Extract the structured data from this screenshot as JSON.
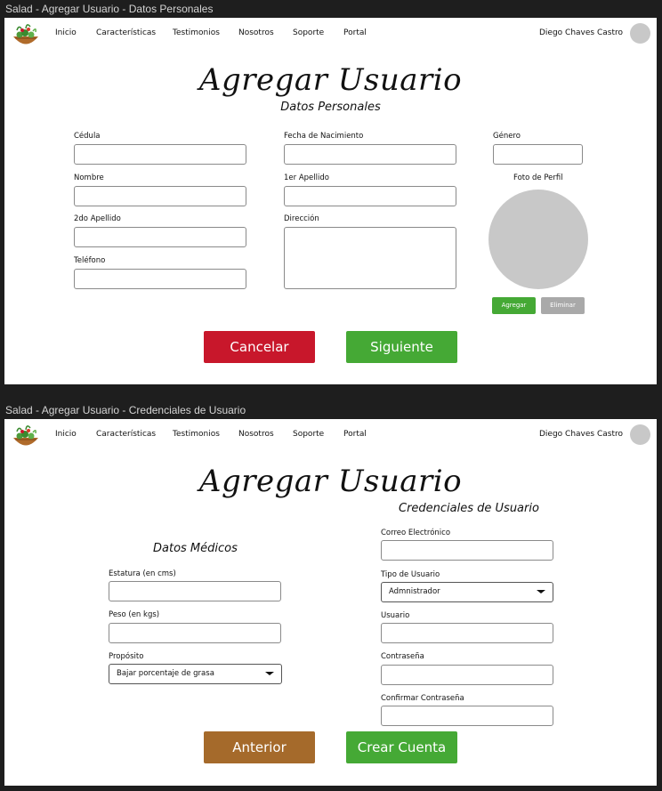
{
  "frames": [
    {
      "title": "Salad - Agregar Usuario - Datos Personales"
    },
    {
      "title": "Salad - Agregar Usuario - Credenciales de Usuario"
    }
  ],
  "nav": {
    "items": [
      "Inicio",
      "Características",
      "Testimonios",
      "Nosotros",
      "Soporte",
      "Portal"
    ],
    "user_name": "Diego Chaves Castro"
  },
  "page_title": "Agregar Usuario",
  "personal": {
    "subtitle": "Datos Personales",
    "fields": {
      "cedula": "Cédula",
      "fecha_nacimiento": "Fecha de Nacimiento",
      "genero": "Género",
      "nombre": "Nombre",
      "primer_apellido": "1er Apellido",
      "segundo_apellido": "2do Apellido",
      "direccion": "Dirección",
      "telefono": "Teléfono"
    },
    "photo_label": "Foto de Perfil",
    "add_photo": "Agregar",
    "remove_photo": "Eliminar",
    "cancel": "Cancelar",
    "next": "Siguiente"
  },
  "medical": {
    "subtitle": "Datos Médicos",
    "estatura": "Estatura (en cms)",
    "peso": "Peso (en kgs)",
    "proposito": "Propósito",
    "proposito_value": "Bajar porcentaje de grasa"
  },
  "credentials": {
    "subtitle": "Credenciales de Usuario",
    "correo": "Correo Electrónico",
    "tipo": "Tipo de Usuario",
    "tipo_value": "Admnistrador",
    "usuario": "Usuario",
    "contrasena": "Contraseña",
    "confirmar": "Confirmar Contraseña",
    "back": "Anterior",
    "create": "Crear Cuenta"
  },
  "colors": {
    "green": "#45a935",
    "red": "#c8172b",
    "brown": "#a56a2b",
    "gray": "#a9a9a9"
  }
}
